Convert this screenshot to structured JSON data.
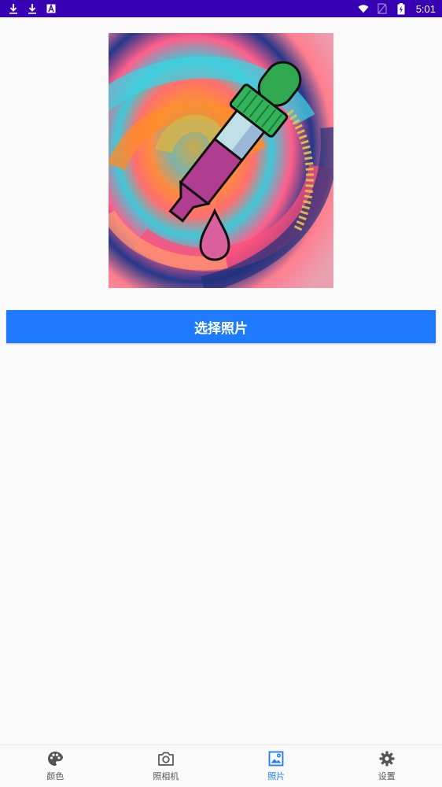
{
  "status_bar": {
    "time": "5:01",
    "left_icons": [
      "download-icon",
      "download-icon",
      "font-a-icon"
    ],
    "right_icons": [
      "wifi-icon",
      "no-sim-icon",
      "battery-charging-icon"
    ]
  },
  "main": {
    "image": "color-dropper-illustration",
    "select_button_label": "选择照片"
  },
  "bottom_nav": {
    "items": [
      {
        "label": "颜色",
        "icon": "palette-icon"
      },
      {
        "label": "照相机",
        "icon": "camera-icon"
      },
      {
        "label": "照片",
        "icon": "image-icon"
      },
      {
        "label": "设置",
        "icon": "gear-icon"
      }
    ],
    "active_index": 2
  },
  "colors": {
    "status_bar": "#3700b3",
    "accent": "#1e7bff",
    "background": "#fafafa"
  }
}
